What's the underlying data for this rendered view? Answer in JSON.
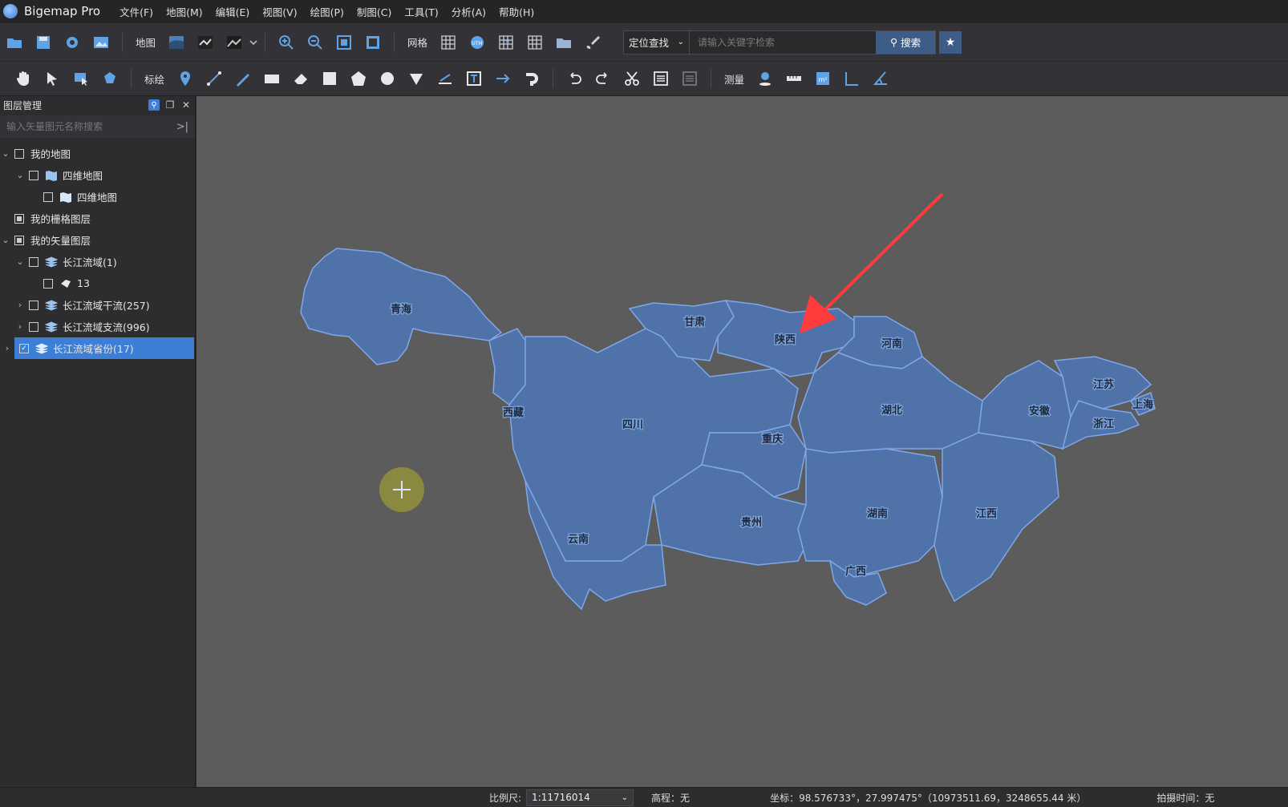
{
  "app": {
    "title": "Bigemap Pro"
  },
  "menu": [
    "文件(F)",
    "地图(M)",
    "编辑(E)",
    "视图(V)",
    "绘图(P)",
    "制图(C)",
    "工具(T)",
    "分析(A)",
    "帮助(H)"
  ],
  "toolbar1": {
    "map_label": "地图",
    "grid_label": "网格",
    "search_scope": "定位查找",
    "search_placeholder": "请输入关键字检索",
    "search_button": "搜索"
  },
  "toolbar2": {
    "mark_label": "标绘",
    "measure_label": "测量"
  },
  "layer_panel": {
    "title": "图层管理",
    "search_placeholder": "输入矢量图元名称搜索",
    "rows": [
      {
        "label": "我的地图"
      },
      {
        "label": "四维地图"
      },
      {
        "label": "四维地图"
      },
      {
        "label": "我的栅格图层"
      },
      {
        "label": "我的矢量图层"
      },
      {
        "label": "长江流域(1)"
      },
      {
        "label": "13"
      },
      {
        "label": "长江流域干流(257)"
      },
      {
        "label": "长江流域支流(996)"
      },
      {
        "label": "长江流域省份(17)"
      }
    ]
  },
  "map": {
    "fill_color": "#4f72a8",
    "border_color": "#7fa7ea",
    "background_color": "#5c5c5c",
    "provinces": [
      "青海",
      "甘肃",
      "陕西",
      "河南",
      "西藏",
      "四川",
      "重庆",
      "湖北",
      "安徽",
      "江苏",
      "上海",
      "浙江",
      "云南",
      "贵州",
      "湖南",
      "江西",
      "广西"
    ]
  },
  "status": {
    "scale_label": "比例尺:",
    "scale_value": "1:11716014",
    "elevation": "高程：无",
    "coordinates": "坐标：98.576733°，27.997475°（10973511.69，3248655.44 米）",
    "capture_time": "拍摄时间：无"
  }
}
